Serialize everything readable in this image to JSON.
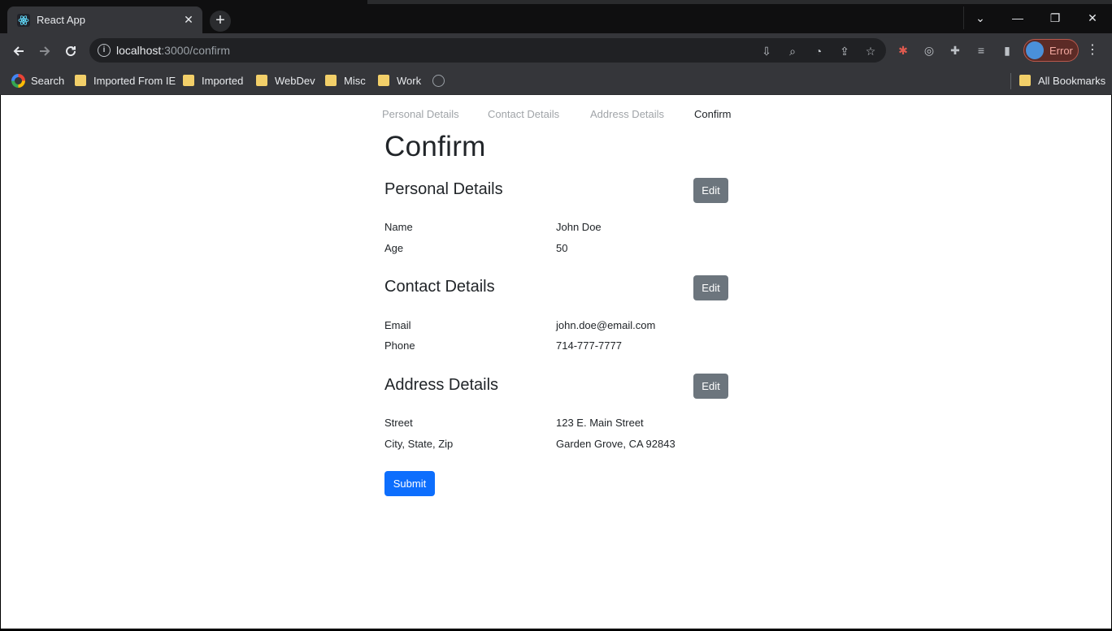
{
  "browser": {
    "tab_title": "React App",
    "tab_close": "✕",
    "new_tab": "+",
    "window": {
      "dropdown": "⌄",
      "minimize": "—",
      "restore": "❐",
      "close": "✕"
    },
    "url_host": "localhost",
    "url_path": ":3000/confirm",
    "profile_label": "Error",
    "bookmarks": [
      "Search",
      "Imported From IE",
      "Imported",
      "WebDev",
      "Misc",
      "Work"
    ],
    "all_bookmarks": "All Bookmarks",
    "colors": {
      "frame": "#0f0f10",
      "toolbar": "#35363a",
      "omnibox": "#202124",
      "profile_border": "#b8584c"
    }
  },
  "steps": [
    {
      "label": "Personal Details",
      "active": false
    },
    {
      "label": "Contact Details",
      "active": false
    },
    {
      "label": "Address Details",
      "active": false
    },
    {
      "label": "Confirm",
      "active": true
    }
  ],
  "page": {
    "title": "Confirm",
    "edit_label": "Edit",
    "submit_label": "Submit",
    "sections": [
      {
        "title": "Personal Details",
        "rows": [
          {
            "label": "Name",
            "value": "John Doe"
          },
          {
            "label": "Age",
            "value": "50"
          }
        ]
      },
      {
        "title": "Contact Details",
        "rows": [
          {
            "label": "Email",
            "value": "john.doe@email.com"
          },
          {
            "label": "Phone",
            "value": "714-777-7777"
          }
        ]
      },
      {
        "title": "Address Details",
        "rows": [
          {
            "label": "Street",
            "value": "123 E. Main Street"
          },
          {
            "label": "City, State, Zip",
            "value": "Garden Grove, CA 92843"
          }
        ]
      }
    ],
    "colors": {
      "edit_button": "#6c757d",
      "submit_button": "#0d6efd",
      "text": "#212529",
      "step_inactive": "#a0a4a8"
    }
  }
}
